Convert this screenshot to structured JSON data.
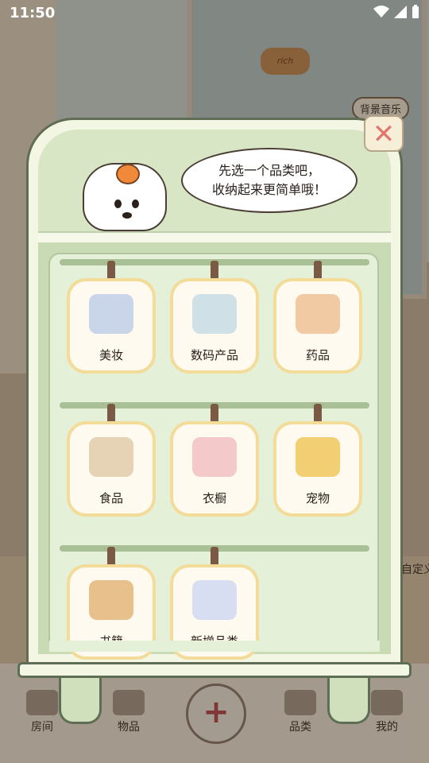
{
  "status_bar": {
    "time": "11:50"
  },
  "background": {
    "sign_text": "rich",
    "music_button": "背景音乐",
    "custom_label": "自定义"
  },
  "dialog": {
    "speech": [
      "先选一个品类吧，",
      "收纳起来更简单哦！"
    ],
    "categories": [
      {
        "label": "美妆",
        "icon": "makeup-icon",
        "color": "#c9d6ea"
      },
      {
        "label": "数码产品",
        "icon": "digital-devices-icon",
        "color": "#cfe0e6"
      },
      {
        "label": "药品",
        "icon": "medicine-icon",
        "color": "#f1c9a2"
      },
      {
        "label": "食品",
        "icon": "food-icon",
        "color": "#e6d2b5"
      },
      {
        "label": "衣橱",
        "icon": "wardrobe-icon",
        "color": "#f3c9c9"
      },
      {
        "label": "宠物",
        "icon": "pet-icon",
        "color": "#f2cf72"
      },
      {
        "label": "书籍",
        "icon": "books-icon",
        "color": "#e7c08c"
      },
      {
        "label": "新增品类",
        "icon": "add-category-icon",
        "color": "#d7def2"
      }
    ],
    "close_icon": "close-icon"
  },
  "nav": {
    "items": [
      {
        "label": "房间",
        "icon": "house-icon"
      },
      {
        "label": "物品",
        "icon": "box-icon"
      },
      {
        "label": "品类",
        "icon": "boxes-icon"
      },
      {
        "label": "我的",
        "icon": "dog-face-icon"
      }
    ],
    "add_icon": "plus-icon",
    "add_label": "+"
  }
}
